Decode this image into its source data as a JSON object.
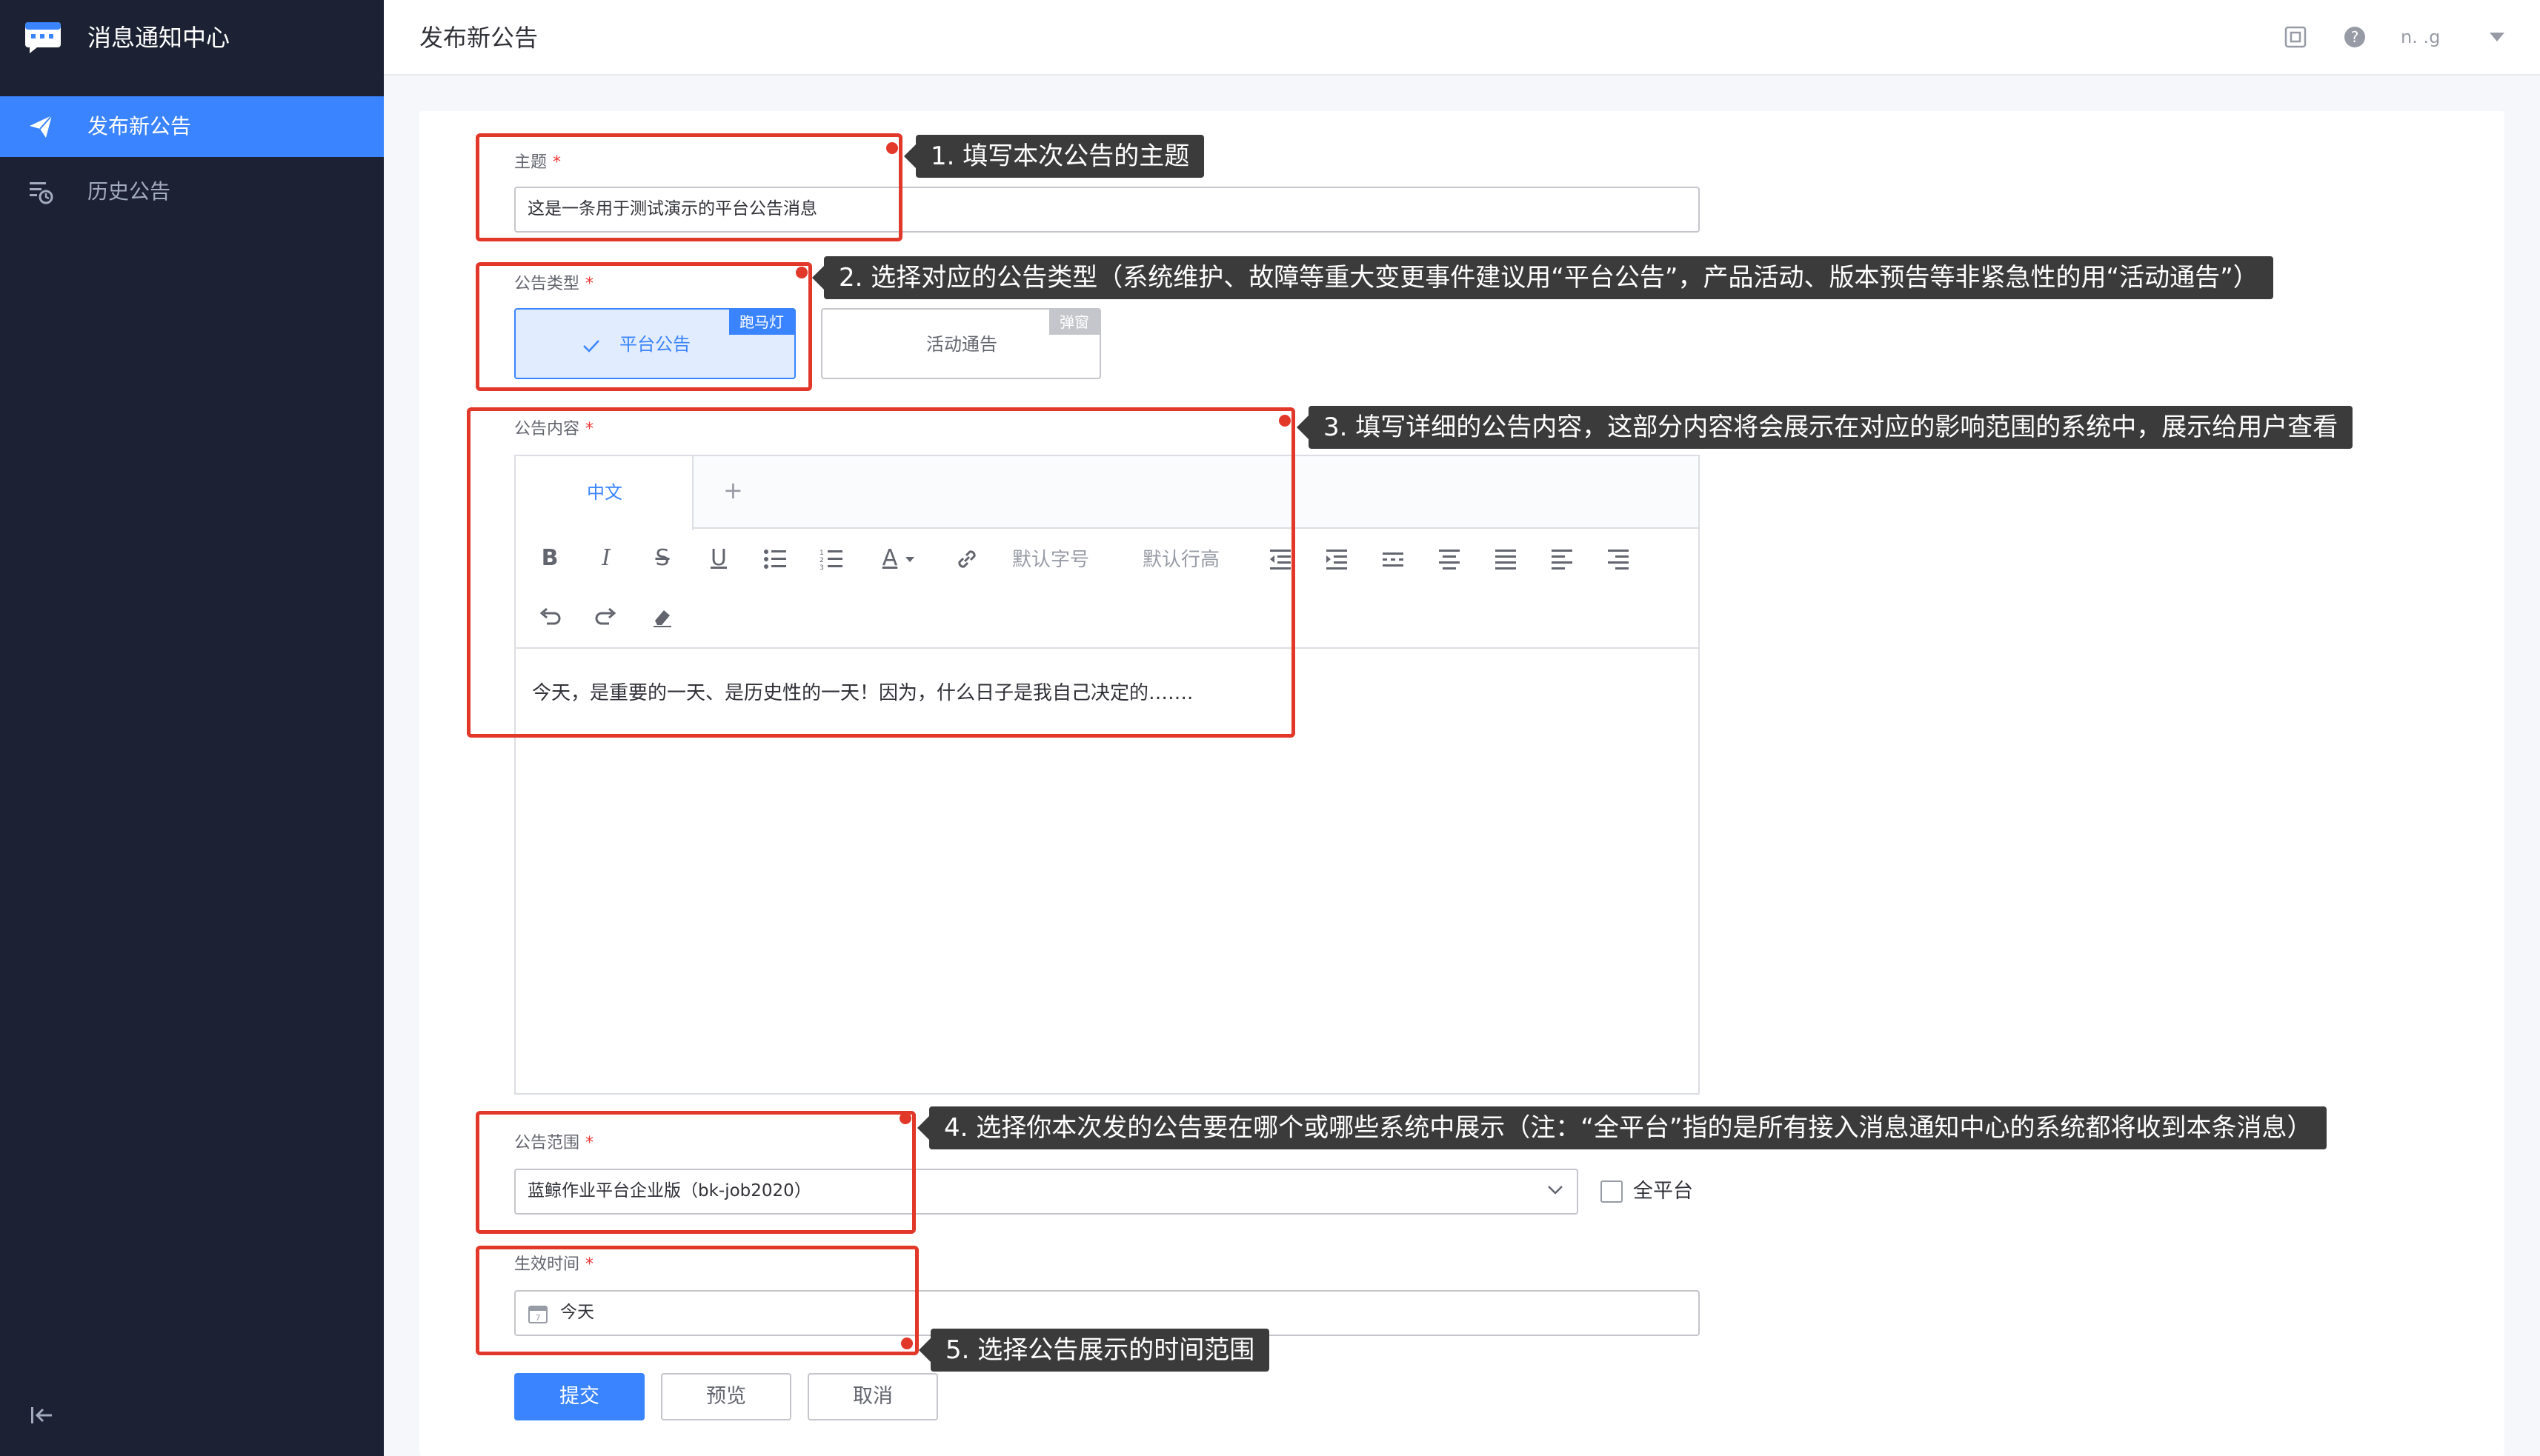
{
  "app": {
    "title": "消息通知中心",
    "accent_color": "#3a84ff",
    "sidebar_bg": "#1c2233",
    "annotation_color": "#e2382a"
  },
  "sidebar": {
    "items": [
      {
        "label": "发布新公告",
        "icon": "send-icon",
        "active": true
      },
      {
        "label": "历史公告",
        "icon": "history-list-icon",
        "active": false
      }
    ],
    "collapse_icon": "collapse-left-icon"
  },
  "header": {
    "title": "发布新公告",
    "icons": [
      "screen-capture-icon",
      "help-icon"
    ],
    "user": "n.  .g"
  },
  "form": {
    "subject": {
      "label": "主题",
      "required_mark": "*",
      "value": "这是一条用于测试演示的平台公告消息"
    },
    "type": {
      "label": "公告类型",
      "required_mark": "*",
      "options": [
        {
          "label": "平台公告",
          "tag": "跑马灯",
          "selected": true
        },
        {
          "label": "活动通告",
          "tag": "弹窗",
          "selected": false
        }
      ]
    },
    "content": {
      "label": "公告内容",
      "required_mark": "*",
      "tabs": [
        "中文"
      ],
      "add_tab": "+",
      "toolbar": {
        "bold": "B",
        "italic": "I",
        "strike": "S",
        "underline": "U",
        "font_color": "A",
        "font_size": "默认字号",
        "line_height": "默认行高"
      },
      "text": "今天，是重要的一天、是历史性的一天！因为，什么日子是我自己决定的……."
    },
    "scope": {
      "label": "公告范围",
      "required_mark": "*",
      "value": "蓝鲸作业平台企业版（bk-job2020）",
      "all_platform_label": "全平台",
      "all_platform_checked": false
    },
    "effective_time": {
      "label": "生效时间",
      "required_mark": "*",
      "value": "今天"
    },
    "buttons": {
      "submit": "提交",
      "preview": "预览",
      "cancel": "取消"
    }
  },
  "annotations": [
    {
      "text": "1. 填写本次公告的主题"
    },
    {
      "text": "2. 选择对应的公告类型（系统维护、故障等重大变更事件建议用“平台公告”，产品活动、版本预告等非紧急性的用“活动通告”）"
    },
    {
      "text": "3. 填写详细的公告内容，这部分内容将会展示在对应的影响范围的系统中，展示给用户查看"
    },
    {
      "text": "4. 选择你本次发的公告要在哪个或哪些系统中展示（注：“全平台”指的是所有接入消息通知中心的系统都将收到本条消息）"
    },
    {
      "text": "5. 选择公告展示的时间范围"
    }
  ]
}
